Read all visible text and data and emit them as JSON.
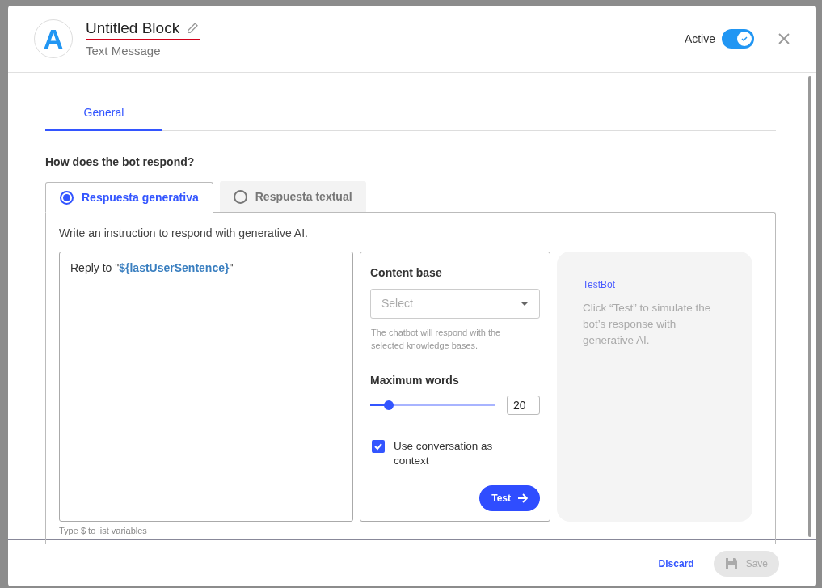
{
  "header": {
    "avatar_letter": "A",
    "title": "Untitled Block",
    "subtitle": "Text Message",
    "active_label": "Active",
    "active_on": true
  },
  "tabs": [
    {
      "label": "General",
      "selected": true
    }
  ],
  "question": "How does the bot respond?",
  "response_types": [
    {
      "label": "Respuesta generativa",
      "selected": true
    },
    {
      "label": "Respuesta textual",
      "selected": false
    }
  ],
  "instruction": "Write an instruction to respond with generative AI.",
  "prompt": {
    "value": "Reply to \"**${lastUserSentence}**\"",
    "hint": "Type $ to list variables"
  },
  "settings": {
    "content_base_label": "Content base",
    "select_placeholder": "Select",
    "select_help": "The chatbot will respond with the selected knowledge bases.",
    "max_words_label": "Maximum words",
    "level": 0.15,
    "max_words_value": "20",
    "context_label": "Use conversation as context",
    "context_checked": true,
    "test_button": "Test"
  },
  "testbot": {
    "title": "TestBot",
    "message": "Click “Test” to simulate the bot’s response with generative AI."
  },
  "footer": {
    "discard": "Discard",
    "save": "Save",
    "save_disabled": true
  }
}
